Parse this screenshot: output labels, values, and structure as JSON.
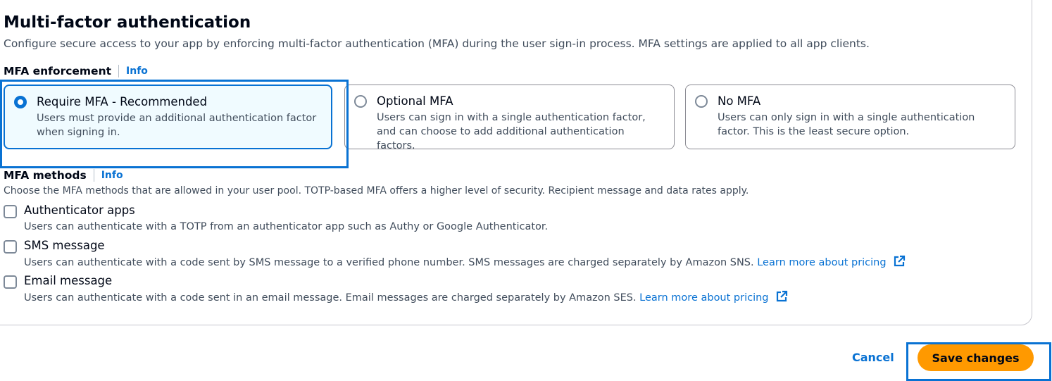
{
  "section": {
    "title": "Multi-factor authentication",
    "description": "Configure secure access to your app by enforcing multi-factor authentication (MFA) during the user sign-in process. MFA settings are applied to all app clients."
  },
  "enforcement": {
    "label": "MFA enforcement",
    "info": "Info",
    "options": [
      {
        "title": "Require MFA - Recommended",
        "description": "Users must provide an additional authentication factor when signing in.",
        "selected": true
      },
      {
        "title": "Optional MFA",
        "description": "Users can sign in with a single authentication factor, and can choose to add additional authentication factors.",
        "selected": false
      },
      {
        "title": "No MFA",
        "description": "Users can only sign in with a single authentication factor. This is the least secure option.",
        "selected": false
      }
    ]
  },
  "methods": {
    "label": "MFA methods",
    "info": "Info",
    "description": "Choose the MFA methods that are allowed in your user pool. TOTP-based MFA offers a higher level of security. Recipient message and data rates apply.",
    "items": [
      {
        "title": "Authenticator apps",
        "description": "Users can authenticate with a TOTP from an authenticator app such as Authy or Google Authenticator.",
        "link": "",
        "checked": false
      },
      {
        "title": "SMS message",
        "description": "Users can authenticate with a code sent by SMS message to a verified phone number. SMS messages are charged separately by Amazon SNS.",
        "link": "Learn more about pricing",
        "checked": false
      },
      {
        "title": "Email message",
        "description": "Users can authenticate with a code sent in an email message. Email messages are charged separately by Amazon SES.",
        "link": "Learn more about pricing",
        "checked": false
      }
    ]
  },
  "actions": {
    "cancel": "Cancel",
    "save": "Save changes"
  },
  "colors": {
    "accent": "#0972d3",
    "primary_button": "#ff9900",
    "selected_tile_bg": "#f0fbff"
  },
  "icons": {
    "external_link": "external-link-icon"
  }
}
